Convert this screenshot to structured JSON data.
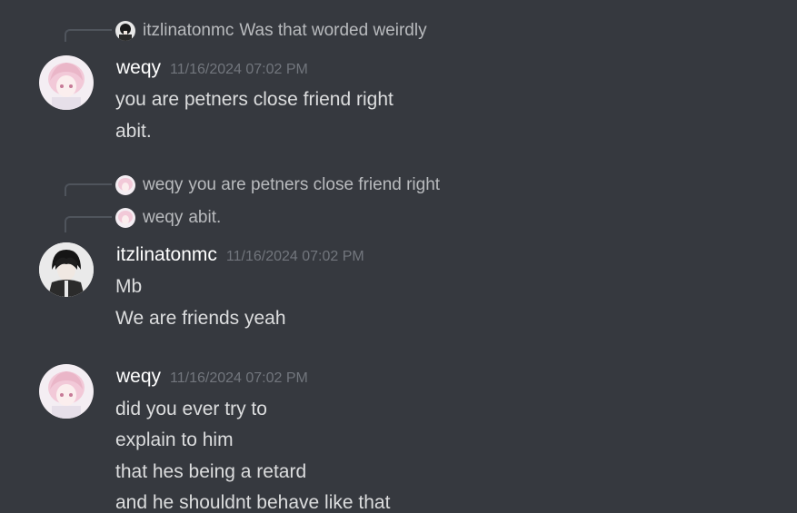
{
  "colors": {
    "background": "#36393f",
    "username": "#ffffff",
    "timestamp": "#72767d",
    "message_text": "#dcddde",
    "reply_text": "#b9bbbe",
    "spine": "#4f545c"
  },
  "block1": {
    "reply": {
      "author": "itzlinatonmc",
      "text": "Was that worded weirdly",
      "avatar_icon": "dark-haired-avatar-icon"
    },
    "author": "weqy",
    "timestamp": "11/16/2024 07:02 PM",
    "avatar_icon": "pink-haired-avatar-icon",
    "lines": [
      "you are petners close friend right",
      "abit."
    ]
  },
  "block2": {
    "replies": [
      {
        "author": "weqy",
        "text": "you are petners close friend right",
        "avatar_icon": "pink-haired-avatar-icon"
      },
      {
        "author": "weqy",
        "text": "abit.",
        "avatar_icon": "pink-haired-avatar-icon"
      }
    ],
    "author": "itzlinatonmc",
    "timestamp": "11/16/2024 07:02 PM",
    "avatar_icon": "dark-haired-avatar-icon",
    "lines": [
      "Mb",
      "We are friends yeah"
    ]
  },
  "block3": {
    "author": "weqy",
    "timestamp": "11/16/2024 07:02 PM",
    "avatar_icon": "pink-haired-avatar-icon",
    "lines": [
      "did you ever try to",
      "explain to him",
      "that hes being a retard",
      "and he shouldnt behave like that"
    ]
  }
}
